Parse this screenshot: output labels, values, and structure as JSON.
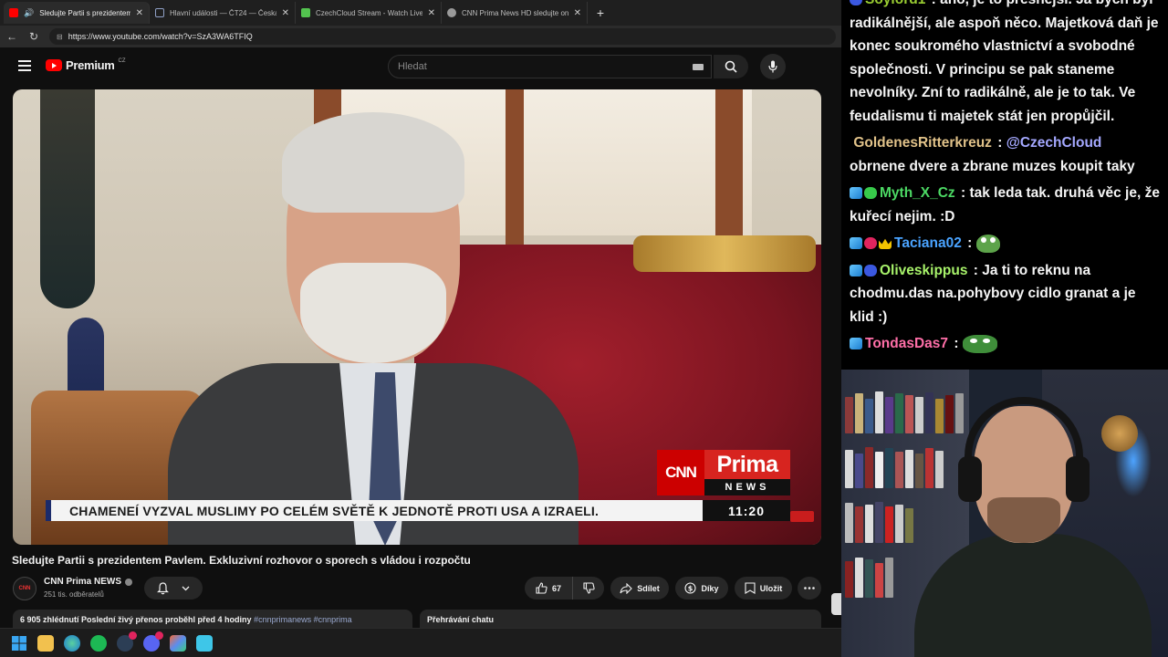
{
  "browser": {
    "tabs": [
      {
        "title": "Sledujte Partii s prezidentem P",
        "color": "#ff0000",
        "active": true
      },
      {
        "title": "Hlavní události — ČT24 — Česká",
        "color": "#6a7fa8",
        "active": false
      },
      {
        "title": "CzechCloud Stream - Watch Live o",
        "color": "#53c34f",
        "active": false
      },
      {
        "title": "CNN Prima News HD sledujte onli",
        "color": "#9a9a9a",
        "active": false
      }
    ],
    "url": "https://www.youtube.com/watch?v=SzA3WA6TFIQ"
  },
  "youtube": {
    "logo_text": "Premium",
    "region": "CZ",
    "search_placeholder": "Hledat"
  },
  "video": {
    "ticker": "CHAMENEÍ VYZVAL MUSLIMY PO CELÉM SVĚTĚ K JEDNOTĚ PROTI USA A IZRAELI.",
    "time": "11:20",
    "logo_cnn": "CNN",
    "logo_prima": "Prima",
    "logo_news": "NEWS",
    "title": "Sledujte Partii s prezidentem Pavlem. Exkluzivní rozhovor o sporech s vládou i rozpočtu"
  },
  "channel": {
    "name": "CNN Prima NEWS",
    "subscribers": "251 tis. odběratelů",
    "avatar_text": "CNN"
  },
  "actions": {
    "likes": "67",
    "share": "Sdílet",
    "thanks": "Díky",
    "save": "Uložit"
  },
  "description": {
    "stats": "6 905 zhlédnutí  Poslední živý přenos proběhl před 4 hodiny",
    "tags": "#cnnprimanews #cnnprima"
  },
  "chat_replay_label": "Přehrávání chatu",
  "chat": [
    {
      "user": "Soylord1",
      "color": "#9acd32",
      "badges": [
        "gem-blue"
      ],
      "text": "ano, je to přesnější. Já bych byl radikálnější, ale aspoň něco. Majetková daň je konec soukromého vlastnictví a svobodné společnosti. V principu se pak staneme nevolníky. Zní to radikálně, ale je to tak. Ve feudalismu ti majetek stát jen propůjčil."
    },
    {
      "user": "GoldenesRitterkreuz",
      "color": "#e2c38a",
      "badges": [],
      "mention": "@CzechCloud",
      "text": "obrnene dvere a zbrane muzes koupit taky"
    },
    {
      "user": "Myth_X_Cz",
      "color": "#4cd964",
      "badges": [
        "cube",
        "gem-green"
      ],
      "text": "tak leda tak. druhá věc je, že kuřecí nejim. :D"
    },
    {
      "user": "Taciana02",
      "color": "#4aa3ff",
      "badges": [
        "cube",
        "heart",
        "crown"
      ],
      "text": "",
      "emote": "frog"
    },
    {
      "user": "Oliveskippus",
      "color": "#a7f26a",
      "badges": [
        "cube",
        "gem-blue"
      ],
      "text": "Ja ti to reknu na chodmu.das na.pohybovy cidlo granat a je klid :)"
    },
    {
      "user": "TondasDas7",
      "color": "#ff6fa8",
      "badges": [
        "cube"
      ],
      "text": "",
      "emote": "pepe"
    }
  ],
  "colors": {
    "accent_red": "#ff0000",
    "chat_bg": "#000000",
    "page_bg": "#0f0f0f"
  }
}
